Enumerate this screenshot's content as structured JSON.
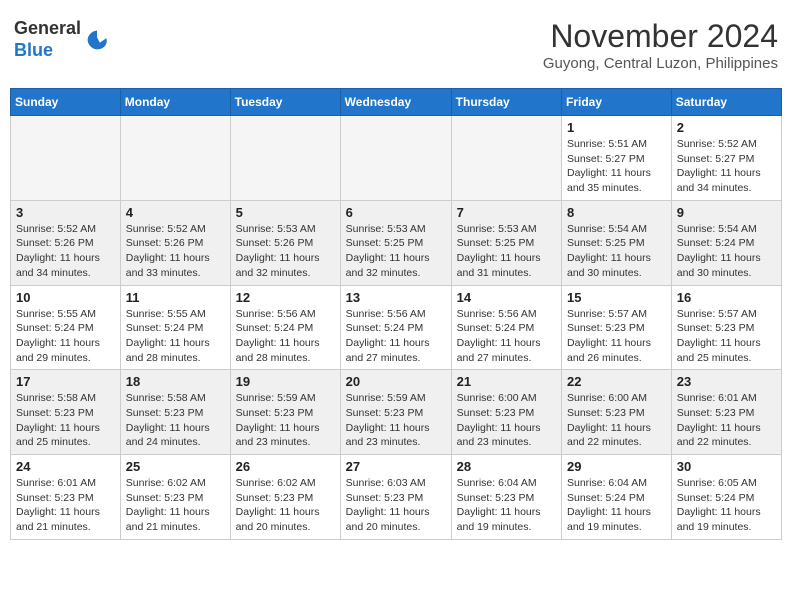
{
  "header": {
    "logo_line1": "General",
    "logo_line2": "Blue",
    "month": "November 2024",
    "location": "Guyong, Central Luzon, Philippines"
  },
  "days_of_week": [
    "Sunday",
    "Monday",
    "Tuesday",
    "Wednesday",
    "Thursday",
    "Friday",
    "Saturday"
  ],
  "weeks": [
    [
      {
        "day": "",
        "empty": true
      },
      {
        "day": "",
        "empty": true
      },
      {
        "day": "",
        "empty": true
      },
      {
        "day": "",
        "empty": true
      },
      {
        "day": "",
        "empty": true
      },
      {
        "day": "1",
        "sunrise": "5:51 AM",
        "sunset": "5:27 PM",
        "daylight": "11 hours and 35 minutes."
      },
      {
        "day": "2",
        "sunrise": "5:52 AM",
        "sunset": "5:27 PM",
        "daylight": "11 hours and 34 minutes."
      }
    ],
    [
      {
        "day": "3",
        "sunrise": "5:52 AM",
        "sunset": "5:26 PM",
        "daylight": "11 hours and 34 minutes."
      },
      {
        "day": "4",
        "sunrise": "5:52 AM",
        "sunset": "5:26 PM",
        "daylight": "11 hours and 33 minutes."
      },
      {
        "day": "5",
        "sunrise": "5:53 AM",
        "sunset": "5:26 PM",
        "daylight": "11 hours and 32 minutes."
      },
      {
        "day": "6",
        "sunrise": "5:53 AM",
        "sunset": "5:25 PM",
        "daylight": "11 hours and 32 minutes."
      },
      {
        "day": "7",
        "sunrise": "5:53 AM",
        "sunset": "5:25 PM",
        "daylight": "11 hours and 31 minutes."
      },
      {
        "day": "8",
        "sunrise": "5:54 AM",
        "sunset": "5:25 PM",
        "daylight": "11 hours and 30 minutes."
      },
      {
        "day": "9",
        "sunrise": "5:54 AM",
        "sunset": "5:24 PM",
        "daylight": "11 hours and 30 minutes."
      }
    ],
    [
      {
        "day": "10",
        "sunrise": "5:55 AM",
        "sunset": "5:24 PM",
        "daylight": "11 hours and 29 minutes."
      },
      {
        "day": "11",
        "sunrise": "5:55 AM",
        "sunset": "5:24 PM",
        "daylight": "11 hours and 28 minutes."
      },
      {
        "day": "12",
        "sunrise": "5:56 AM",
        "sunset": "5:24 PM",
        "daylight": "11 hours and 28 minutes."
      },
      {
        "day": "13",
        "sunrise": "5:56 AM",
        "sunset": "5:24 PM",
        "daylight": "11 hours and 27 minutes."
      },
      {
        "day": "14",
        "sunrise": "5:56 AM",
        "sunset": "5:24 PM",
        "daylight": "11 hours and 27 minutes."
      },
      {
        "day": "15",
        "sunrise": "5:57 AM",
        "sunset": "5:23 PM",
        "daylight": "11 hours and 26 minutes."
      },
      {
        "day": "16",
        "sunrise": "5:57 AM",
        "sunset": "5:23 PM",
        "daylight": "11 hours and 25 minutes."
      }
    ],
    [
      {
        "day": "17",
        "sunrise": "5:58 AM",
        "sunset": "5:23 PM",
        "daylight": "11 hours and 25 minutes."
      },
      {
        "day": "18",
        "sunrise": "5:58 AM",
        "sunset": "5:23 PM",
        "daylight": "11 hours and 24 minutes."
      },
      {
        "day": "19",
        "sunrise": "5:59 AM",
        "sunset": "5:23 PM",
        "daylight": "11 hours and 23 minutes."
      },
      {
        "day": "20",
        "sunrise": "5:59 AM",
        "sunset": "5:23 PM",
        "daylight": "11 hours and 23 minutes."
      },
      {
        "day": "21",
        "sunrise": "6:00 AM",
        "sunset": "5:23 PM",
        "daylight": "11 hours and 23 minutes."
      },
      {
        "day": "22",
        "sunrise": "6:00 AM",
        "sunset": "5:23 PM",
        "daylight": "11 hours and 22 minutes."
      },
      {
        "day": "23",
        "sunrise": "6:01 AM",
        "sunset": "5:23 PM",
        "daylight": "11 hours and 22 minutes."
      }
    ],
    [
      {
        "day": "24",
        "sunrise": "6:01 AM",
        "sunset": "5:23 PM",
        "daylight": "11 hours and 21 minutes."
      },
      {
        "day": "25",
        "sunrise": "6:02 AM",
        "sunset": "5:23 PM",
        "daylight": "11 hours and 21 minutes."
      },
      {
        "day": "26",
        "sunrise": "6:02 AM",
        "sunset": "5:23 PM",
        "daylight": "11 hours and 20 minutes."
      },
      {
        "day": "27",
        "sunrise": "6:03 AM",
        "sunset": "5:23 PM",
        "daylight": "11 hours and 20 minutes."
      },
      {
        "day": "28",
        "sunrise": "6:04 AM",
        "sunset": "5:23 PM",
        "daylight": "11 hours and 19 minutes."
      },
      {
        "day": "29",
        "sunrise": "6:04 AM",
        "sunset": "5:24 PM",
        "daylight": "11 hours and 19 minutes."
      },
      {
        "day": "30",
        "sunrise": "6:05 AM",
        "sunset": "5:24 PM",
        "daylight": "11 hours and 19 minutes."
      }
    ]
  ]
}
